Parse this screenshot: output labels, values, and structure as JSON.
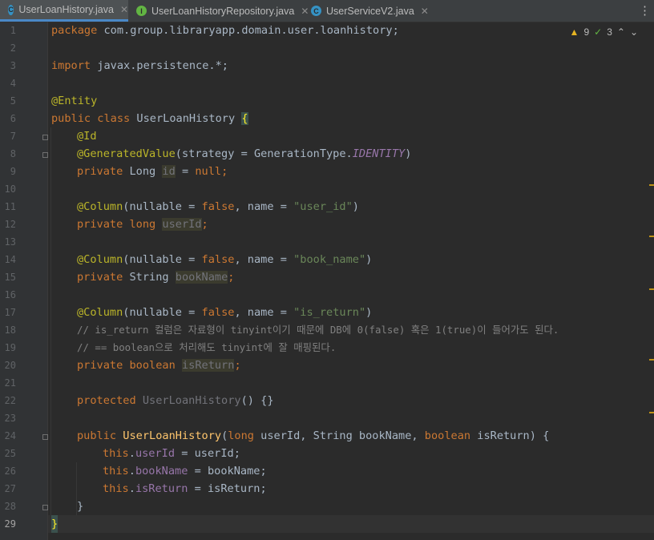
{
  "tabs": [
    {
      "label": "UserLoanHistory.java",
      "icon": "C",
      "active": true
    },
    {
      "label": "UserLoanHistoryRepository.java",
      "icon": "I",
      "active": false
    },
    {
      "label": "UserServiceV2.java",
      "icon": "C",
      "active": false
    }
  ],
  "inspection": {
    "warnings": "9",
    "weak_warnings": "3"
  },
  "line_numbers": [
    "1",
    "2",
    "3",
    "4",
    "5",
    "6",
    "7",
    "8",
    "9",
    "10",
    "11",
    "12",
    "13",
    "14",
    "15",
    "16",
    "17",
    "18",
    "19",
    "20",
    "21",
    "22",
    "23",
    "24",
    "25",
    "26",
    "27",
    "28",
    "29"
  ],
  "code": {
    "l1_kw": "package",
    "l1_rest": " com.group.libraryapp.domain.user.loanhistory;",
    "l3_kw": "import",
    "l3_rest": " javax.persistence.*;",
    "l5": "@Entity",
    "l6_kw": "public class ",
    "l6_name": "UserLoanHistory ",
    "l6_brace": "{",
    "l7": "@Id",
    "l8_ann": "@GeneratedValue",
    "l8_a": "(strategy = GenerationType.",
    "l8_b": "IDENTITY",
    "l8_c": ")",
    "l9_kw": "private ",
    "l9_type": "Long ",
    "l9_name": "id",
    "l9_eq": " = ",
    "l9_null": "null",
    "l9_semi": ";",
    "l11_ann": "@Column",
    "l11_a": "(nullable = ",
    "l11_false": "false",
    "l11_b": ", name = ",
    "l11_str": "\"user_id\"",
    "l11_c": ")",
    "l12_kw": "private long ",
    "l12_name": "userId",
    "l12_semi": ";",
    "l14_ann": "@Column",
    "l14_a": "(nullable = ",
    "l14_false": "false",
    "l14_b": ", name = ",
    "l14_str": "\"book_name\"",
    "l14_c": ")",
    "l15_kw": "private ",
    "l15_type": "String ",
    "l15_name": "bookName",
    "l15_semi": ";",
    "l17_ann": "@Column",
    "l17_a": "(nullable = ",
    "l17_false": "false",
    "l17_b": ", name = ",
    "l17_str": "\"is_return\"",
    "l17_c": ")",
    "l18": "// is_return 컬럼은 자료형이 tinyint이기 때문에 DB에 0(false) 혹은 1(true)이 들어가도 된다.",
    "l19": "// == boolean으로 처리해도 tinyint에 잘 매핑된다.",
    "l20_kw": "private boolean ",
    "l20_name": "isReturn",
    "l20_semi": ";",
    "l22_kw": "protected ",
    "l22_name": "UserLoanHistory",
    "l22_rest": "() {}",
    "l24_kw": "public ",
    "l24_name": "UserLoanHistory",
    "l24_a": "(",
    "l24_t1": "long ",
    "l24_b": "userId, String bookName, ",
    "l24_t2": "boolean ",
    "l24_c": "isReturn) {",
    "l25_this": "this",
    "l25_dot": ".",
    "l25_f": "userId",
    "l25_rest": " = userId;",
    "l26_this": "this",
    "l26_dot": ".",
    "l26_f": "bookName",
    "l26_rest": " = bookName;",
    "l27_this": "this",
    "l27_dot": ".",
    "l27_f": "isReturn",
    "l27_rest": " = isReturn;",
    "l28": "}",
    "l29": "}"
  }
}
